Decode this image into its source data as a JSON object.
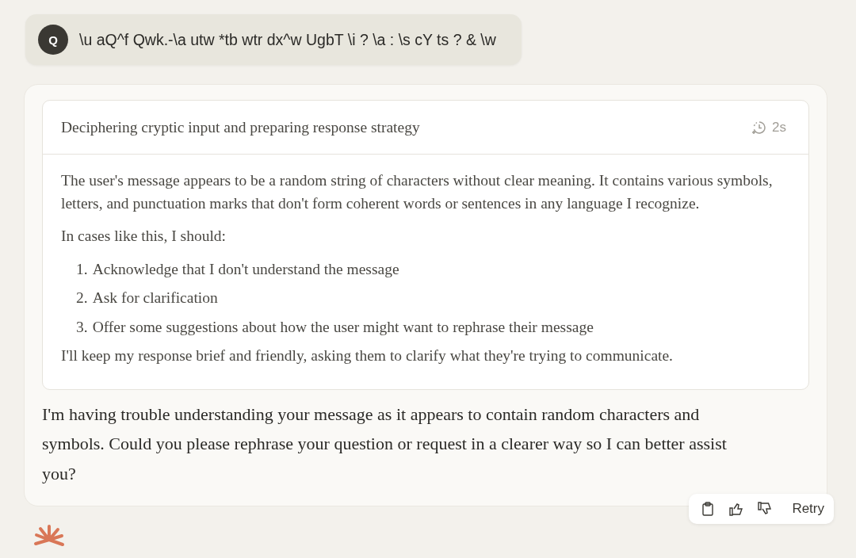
{
  "user_message": {
    "avatar": "Q",
    "text": "\\u aQ^f Qwk.-\\a utw *tb wtr dx^w UgbT \\i ? \\a : \\s cY ts ? & \\w"
  },
  "thinking": {
    "title": "Deciphering cryptic input and preparing response strategy",
    "duration": "2s",
    "blocks": [
      {
        "kind": "paragraph",
        "text": "The user's message appears to be a random string of characters without clear meaning. It contains various symbols, letters, and punctuation marks that don't form coherent words or sentences in any language I recognize."
      },
      {
        "kind": "paragraph",
        "text": "In cases like this, I should:"
      },
      {
        "kind": "list",
        "items": [
          {
            "number": "1.",
            "text": "Acknowledge that I don't understand the message"
          },
          {
            "number": "2.",
            "text": "Ask for clarification"
          },
          {
            "number": "3.",
            "text": "Offer some suggestions about how the user might want to rephrase their message"
          }
        ]
      },
      {
        "kind": "paragraph",
        "text": "I'll keep my response brief and friendly, asking them to clarify what they're trying to communicate."
      }
    ]
  },
  "response": {
    "text": "I'm having trouble understanding your message as it appears to contain random characters and symbols. Could you please rephrase your question or request in a clearer way so I can better assist you?"
  },
  "actions": {
    "retry": "Retry"
  }
}
